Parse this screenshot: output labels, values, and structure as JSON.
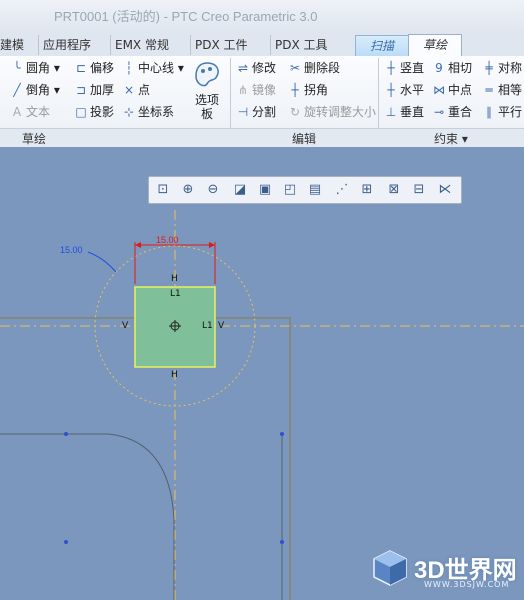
{
  "window": {
    "title": "PRT0001 (活动的) - PTC Creo Parametric 3.0"
  },
  "tabs": [
    {
      "label": "建模"
    },
    {
      "label": "应用程序"
    },
    {
      "label": "EMX 常规"
    },
    {
      "label": "PDX 工件"
    },
    {
      "label": "PDX 工具"
    },
    {
      "label": "扫描"
    },
    {
      "label": "草绘"
    }
  ],
  "ribbon": {
    "sketch": {
      "fillet": "圆角",
      "chamfer": "倒角",
      "text": "文本",
      "offset": "偏移",
      "thicken": "加厚",
      "project": "投影",
      "centerline": "中心线",
      "point": "点",
      "coord_sys": "坐标系",
      "palette": "选项板"
    },
    "edit": {
      "modify": "修改",
      "delete_segment": "删除段",
      "mirror": "镜像",
      "corner": "拐角",
      "divide": "分割",
      "rotate_resize": "旋转调整大小"
    },
    "constrain": {
      "vertical": "竖直",
      "tangent": "相切",
      "symmetric": "对称",
      "horizontal": "水平",
      "midpoint": "中点",
      "equal": "相等",
      "perpendicular": "垂直",
      "coincident": "重合",
      "parallel": "平行"
    }
  },
  "group_labels": {
    "sketch": "草绘",
    "edit": "编辑",
    "constrain": "约束 ▾"
  },
  "sketch": {
    "dim_width": "15.00",
    "dim_circle": "15.00",
    "constraint_h": "H",
    "constraint_l1": "L1",
    "constraint_v": "V"
  },
  "watermark": {
    "brand": "3D世界网",
    "url": "WWW.3DSJW.COM"
  },
  "colors": {
    "canvas": "#7b97bd",
    "rect_fill": "#7fc09a",
    "rect_edge": "#e8f25a",
    "dimension": "#e01818",
    "circle_dim": "#1c4fe0"
  }
}
